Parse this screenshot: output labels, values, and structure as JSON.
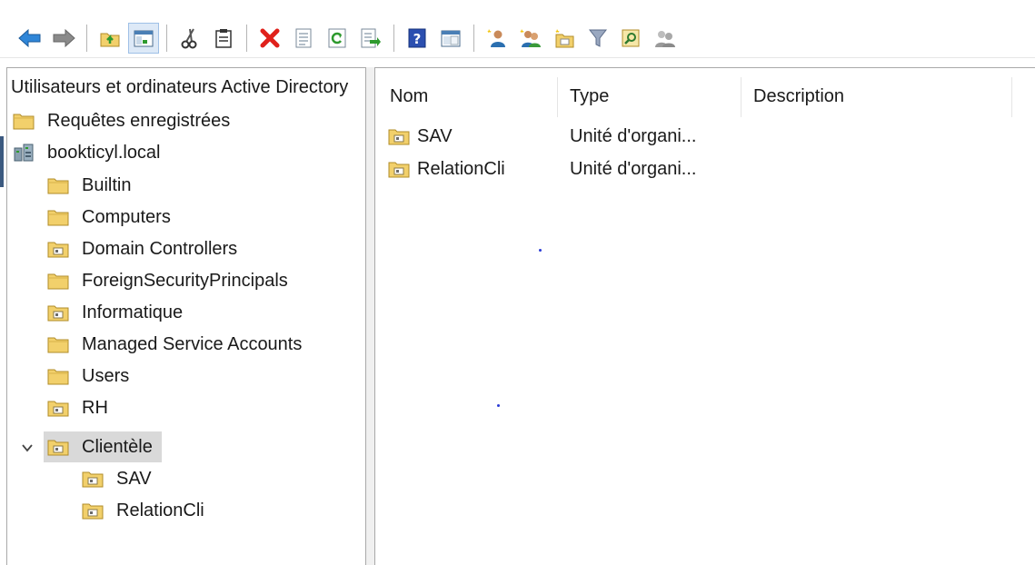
{
  "toolbar": {
    "buttons": [
      {
        "name": "back-arrow-icon",
        "group": 1
      },
      {
        "name": "forward-arrow-icon",
        "group": 1
      },
      {
        "name": "up-folder-icon",
        "group": 2
      },
      {
        "name": "show-hide-tree-icon",
        "group": 2,
        "active": true
      },
      {
        "name": "cut-icon",
        "group": 3
      },
      {
        "name": "paste-icon",
        "group": 3
      },
      {
        "name": "delete-icon",
        "group": 4
      },
      {
        "name": "properties-icon",
        "group": 4
      },
      {
        "name": "refresh-icon",
        "group": 4
      },
      {
        "name": "export-list-icon",
        "group": 4
      },
      {
        "name": "help-icon",
        "group": 5
      },
      {
        "name": "console-view-icon",
        "group": 5
      },
      {
        "name": "new-user-icon",
        "group": 6
      },
      {
        "name": "new-group-icon",
        "group": 6
      },
      {
        "name": "new-ou-icon",
        "group": 6
      },
      {
        "name": "filter-icon",
        "group": 6
      },
      {
        "name": "find-icon",
        "group": 6
      },
      {
        "name": "add-to-group-icon",
        "group": 6
      }
    ]
  },
  "tree": {
    "root_label": "Utilisateurs et ordinateurs Active Directory",
    "items": [
      {
        "label": "Requêtes enregistrées",
        "icon": "folder-icon"
      },
      {
        "label": "bookticyl.local",
        "icon": "domain-icon"
      },
      {
        "label": "Builtin",
        "icon": "folder-icon"
      },
      {
        "label": "Computers",
        "icon": "folder-icon"
      },
      {
        "label": "Domain Controllers",
        "icon": "ou-folder-icon"
      },
      {
        "label": "ForeignSecurityPrincipals",
        "icon": "folder-icon"
      },
      {
        "label": "Informatique",
        "icon": "ou-folder-icon"
      },
      {
        "label": "Managed Service Accounts",
        "icon": "folder-icon"
      },
      {
        "label": "Users",
        "icon": "folder-icon"
      },
      {
        "label": "RH",
        "icon": "ou-folder-icon"
      },
      {
        "label": "Clientèle",
        "icon": "ou-folder-icon",
        "expanded": true,
        "selected": true
      },
      {
        "label": "SAV",
        "icon": "ou-folder-icon"
      },
      {
        "label": "RelationCli",
        "icon": "ou-folder-icon"
      }
    ]
  },
  "list": {
    "columns": {
      "name": "Nom",
      "type": "Type",
      "description": "Description"
    },
    "rows": [
      {
        "name": "SAV",
        "type": "Unité d'organi...",
        "description": ""
      },
      {
        "name": "RelationCli",
        "type": "Unité d'organi...",
        "description": ""
      }
    ]
  },
  "colors": {
    "selection": "#d9d9d9",
    "folder_yellow": "#f2d06b",
    "active_button": "#dde9f7"
  }
}
